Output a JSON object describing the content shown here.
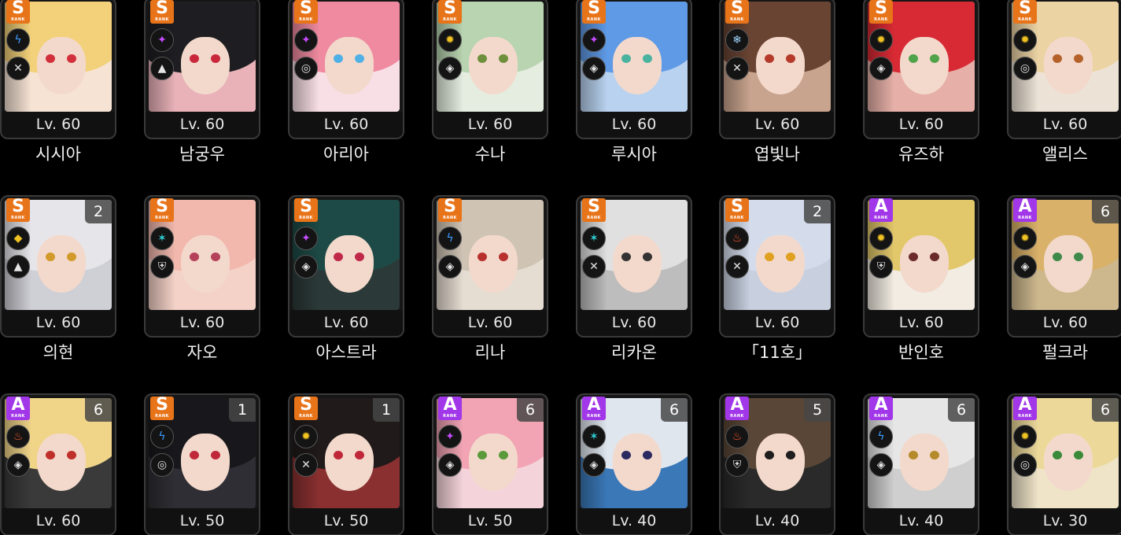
{
  "colors": {
    "s_rank": "#e8741a",
    "a_rank": "#a137e8",
    "electric": "#3b9cff",
    "ether": "#c64bff",
    "physical": "#f0c322",
    "ice": "#9fd6ff",
    "fire": "#ff5a2a"
  },
  "rank_sub_label": "RANK",
  "characters": [
    {
      "name": "시시아",
      "level": "Lv. 60",
      "rank": "S",
      "attribute": "electric-icon",
      "attribute_glyph": "ϟ",
      "attribute_color": "#3b9cff",
      "specialty": "attack-icon",
      "specialty_glyph": "✕",
      "count": "",
      "hair_color": "#f3d17a",
      "eye_color": "#d2303a",
      "bg_color": "#f6e3d4"
    },
    {
      "name": "남궁우",
      "level": "Lv. 60",
      "rank": "S",
      "attribute": "ether-icon",
      "attribute_glyph": "✦",
      "attribute_color": "#c64bff",
      "specialty": "anomaly-icon",
      "specialty_glyph": "▲",
      "count": "",
      "hair_color": "#1e1e22",
      "eye_color": "#c8283a",
      "bg_color": "#e8b2b8"
    },
    {
      "name": "아리아",
      "level": "Lv. 60",
      "rank": "S",
      "attribute": "ether-icon",
      "attribute_glyph": "✦",
      "attribute_color": "#c64bff",
      "specialty": "support-icon",
      "specialty_glyph": "◎",
      "count": "",
      "hair_color": "#f08aa0",
      "eye_color": "#4fb0e6",
      "bg_color": "#f8dfe6"
    },
    {
      "name": "수나",
      "level": "Lv. 60",
      "rank": "S",
      "attribute": "physical-icon",
      "attribute_glyph": "✹",
      "attribute_color": "#f0c322",
      "specialty": "rupture-icon",
      "specialty_glyph": "◈",
      "count": "",
      "hair_color": "#b8d4b0",
      "eye_color": "#6e8f3c",
      "bg_color": "#e4ede0"
    },
    {
      "name": "루시아",
      "level": "Lv. 60",
      "rank": "S",
      "attribute": "ether-icon",
      "attribute_glyph": "✦",
      "attribute_color": "#c64bff",
      "specialty": "rupture-icon",
      "specialty_glyph": "◈",
      "count": "",
      "hair_color": "#5f9ae6",
      "eye_color": "#4ab3a0",
      "bg_color": "#b8d2ef"
    },
    {
      "name": "엽빛나",
      "level": "Lv. 60",
      "rank": "S",
      "attribute": "ice-icon",
      "attribute_glyph": "❄",
      "attribute_color": "#9fd6ff",
      "specialty": "attack-icon",
      "specialty_glyph": "✕",
      "count": "",
      "hair_color": "#6a4433",
      "eye_color": "#b53a2a",
      "bg_color": "#c8a38d"
    },
    {
      "name": "유즈하",
      "level": "Lv. 60",
      "rank": "S",
      "attribute": "physical-icon",
      "attribute_glyph": "✹",
      "attribute_color": "#f0c322",
      "specialty": "rupture-icon",
      "specialty_glyph": "◈",
      "count": "",
      "hair_color": "#d82a34",
      "eye_color": "#4fa34a",
      "bg_color": "#e6b0a8"
    },
    {
      "name": "앨리스",
      "level": "Lv. 60",
      "rank": "S",
      "attribute": "physical-icon",
      "attribute_glyph": "✹",
      "attribute_color": "#f0c322",
      "specialty": "anomaly-icon",
      "specialty_glyph": "◎",
      "count": "",
      "hair_color": "#ecd3a4",
      "eye_color": "#b5622a",
      "bg_color": "#ece3d6"
    },
    {
      "name": "의현",
      "level": "Lv. 60",
      "rank": "S",
      "attribute": "honed-edge-icon",
      "attribute_glyph": "◆",
      "attribute_color": "#f0c322",
      "specialty": "anomaly-icon",
      "specialty_glyph": "▲",
      "count": "2",
      "hair_color": "#e6e6ea",
      "eye_color": "#d29a2a",
      "bg_color": "#cfcfd6"
    },
    {
      "name": "자오",
      "level": "Lv. 60",
      "rank": "S",
      "attribute": "frost-icon",
      "attribute_glyph": "✶",
      "attribute_color": "#2fd2d8",
      "specialty": "defense-icon",
      "specialty_glyph": "⛨",
      "count": "",
      "hair_color": "#f2b8ad",
      "eye_color": "#b5405a",
      "bg_color": "#f4d2c7"
    },
    {
      "name": "아스트라",
      "level": "Lv. 60",
      "rank": "S",
      "attribute": "ether-icon",
      "attribute_glyph": "✦",
      "attribute_color": "#c64bff",
      "specialty": "support-icon",
      "specialty_glyph": "◈",
      "count": "",
      "hair_color": "#1d4a46",
      "eye_color": "#c0284a",
      "bg_color": "#2b3a38"
    },
    {
      "name": "리나",
      "level": "Lv. 60",
      "rank": "S",
      "attribute": "electric-icon",
      "attribute_glyph": "ϟ",
      "attribute_color": "#3b9cff",
      "specialty": "support-icon",
      "specialty_glyph": "◈",
      "count": "",
      "hair_color": "#cfc4b4",
      "eye_color": "#b8302e",
      "bg_color": "#e6ddd2"
    },
    {
      "name": "리카온",
      "level": "Lv. 60",
      "rank": "S",
      "attribute": "frost-icon",
      "attribute_glyph": "✶",
      "attribute_color": "#2fd2d8",
      "specialty": "stun-icon",
      "specialty_glyph": "✕",
      "count": "",
      "hair_color": "#e0e0e0",
      "eye_color": "#333333",
      "bg_color": "#bdbdbd"
    },
    {
      "name": "「11호」",
      "level": "Lv. 60",
      "rank": "S",
      "attribute": "fire-icon",
      "attribute_glyph": "♨",
      "attribute_color": "#ff5a2a",
      "specialty": "attack-icon",
      "specialty_glyph": "✕",
      "count": "2",
      "hair_color": "#d4dcec",
      "eye_color": "#e0a020",
      "bg_color": "#c8d0e0"
    },
    {
      "name": "반인호",
      "level": "Lv. 60",
      "rank": "A",
      "attribute": "physical-icon",
      "attribute_glyph": "✹",
      "attribute_color": "#f0c322",
      "specialty": "defense-icon",
      "specialty_glyph": "⛨",
      "count": "",
      "hair_color": "#e2c86a",
      "eye_color": "#6a2a2a",
      "bg_color": "#f2ece2"
    },
    {
      "name": "펄크라",
      "level": "Lv. 60",
      "rank": "A",
      "attribute": "physical-icon",
      "attribute_glyph": "✹",
      "attribute_color": "#f0c322",
      "specialty": "stun-icon",
      "specialty_glyph": "◈",
      "count": "6",
      "hair_color": "#d9b169",
      "eye_color": "#3f8a4a",
      "bg_color": "#cdb88e"
    },
    {
      "name": "",
      "level": "Lv. 60",
      "rank": "A",
      "attribute": "fire-icon",
      "attribute_glyph": "♨",
      "attribute_color": "#ff5a2a",
      "specialty": "rupture-icon",
      "specialty_glyph": "◈",
      "count": "6",
      "hair_color": "#f0d488",
      "eye_color": "#c0302a",
      "bg_color": "#3a3a3a"
    },
    {
      "name": "",
      "level": "Lv. 50",
      "rank": "S",
      "attribute": "electric-icon",
      "attribute_glyph": "ϟ",
      "attribute_color": "#3b9cff",
      "specialty": "anomaly-icon",
      "specialty_glyph": "◎",
      "count": "1",
      "hair_color": "#18181c",
      "eye_color": "#c0283a",
      "bg_color": "#2e2e34"
    },
    {
      "name": "",
      "level": "Lv. 50",
      "rank": "S",
      "attribute": "physical-icon",
      "attribute_glyph": "✹",
      "attribute_color": "#f0c322",
      "specialty": "attack-icon",
      "specialty_glyph": "✕",
      "count": "1",
      "hair_color": "#201a1a",
      "eye_color": "#c0283a",
      "bg_color": "#8a3030"
    },
    {
      "name": "",
      "level": "Lv. 50",
      "rank": "A",
      "attribute": "ether-icon",
      "attribute_glyph": "✦",
      "attribute_color": "#c64bff",
      "specialty": "rupture-icon",
      "specialty_glyph": "◈",
      "count": "6",
      "hair_color": "#f2a4b4",
      "eye_color": "#5a9a3a",
      "bg_color": "#f4d4da"
    },
    {
      "name": "",
      "level": "Lv. 40",
      "rank": "A",
      "attribute": "frost-icon",
      "attribute_glyph": "✶",
      "attribute_color": "#2fd2d8",
      "specialty": "rupture-icon",
      "specialty_glyph": "◈",
      "count": "6",
      "hair_color": "#dfe6ee",
      "eye_color": "#2a2a60",
      "bg_color": "#3a78b8"
    },
    {
      "name": "",
      "level": "Lv. 40",
      "rank": "A",
      "attribute": "fire-icon",
      "attribute_glyph": "♨",
      "attribute_color": "#ff5a2a",
      "specialty": "defense-icon",
      "specialty_glyph": "⛨",
      "count": "5",
      "hair_color": "#5a4636",
      "eye_color": "#1e1e1e",
      "bg_color": "#2a2a2a"
    },
    {
      "name": "",
      "level": "Lv. 40",
      "rank": "A",
      "attribute": "electric-icon",
      "attribute_glyph": "ϟ",
      "attribute_color": "#3b9cff",
      "specialty": "stun-icon",
      "specialty_glyph": "◈",
      "count": "6",
      "hair_color": "#e6e6e6",
      "eye_color": "#b58a2a",
      "bg_color": "#cfcfcf"
    },
    {
      "name": "",
      "level": "Lv. 30",
      "rank": "A",
      "attribute": "physical-icon",
      "attribute_glyph": "✹",
      "attribute_color": "#f0c322",
      "specialty": "anomaly-icon",
      "specialty_glyph": "◎",
      "count": "6",
      "hair_color": "#ecd99a",
      "eye_color": "#3a8a3a",
      "bg_color": "#efe4c8"
    }
  ]
}
